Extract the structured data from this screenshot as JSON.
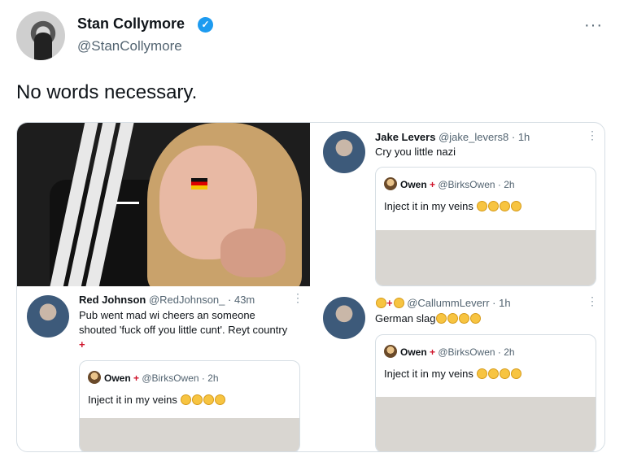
{
  "author": {
    "name": "Stan Collymore",
    "handle": "@StanCollymore"
  },
  "tweet_text": "No words necessary.",
  "more_label": "···",
  "verified_glyph": "✓",
  "screenshots": {
    "jake": {
      "name": "Jake Levers",
      "handle": "@jake_levers8",
      "time": "· 1h",
      "text": "Cry you little nazi",
      "quote": {
        "name": "Owen",
        "handle": "@BirksOwen",
        "time": "· 2h",
        "text": "Inject it in my veins"
      }
    },
    "red": {
      "name": "Red Johnson",
      "handle": "@RedJohnson_",
      "time": "· 43m",
      "text": "Pub went mad wi cheers an someone shouted 'fuck off you little cunt'. Reyt country",
      "quote": {
        "name": "Owen",
        "handle": "@BirksOwen",
        "time": "· 2h",
        "text": "Inject it in my veins"
      }
    },
    "callum": {
      "handle": "@CallummLeverr",
      "time": "· 1h",
      "text": "German slag",
      "quote": {
        "name": "Owen",
        "handle": "@BirksOwen",
        "time": "· 2h",
        "text": "Inject it in my veins"
      }
    }
  },
  "icons": {
    "england_flag": "+",
    "verified": "verified-badge-icon"
  },
  "colors": {
    "verified_blue": "#1d9bf0",
    "muted_text": "#536471",
    "england_red": "#cf142b"
  }
}
